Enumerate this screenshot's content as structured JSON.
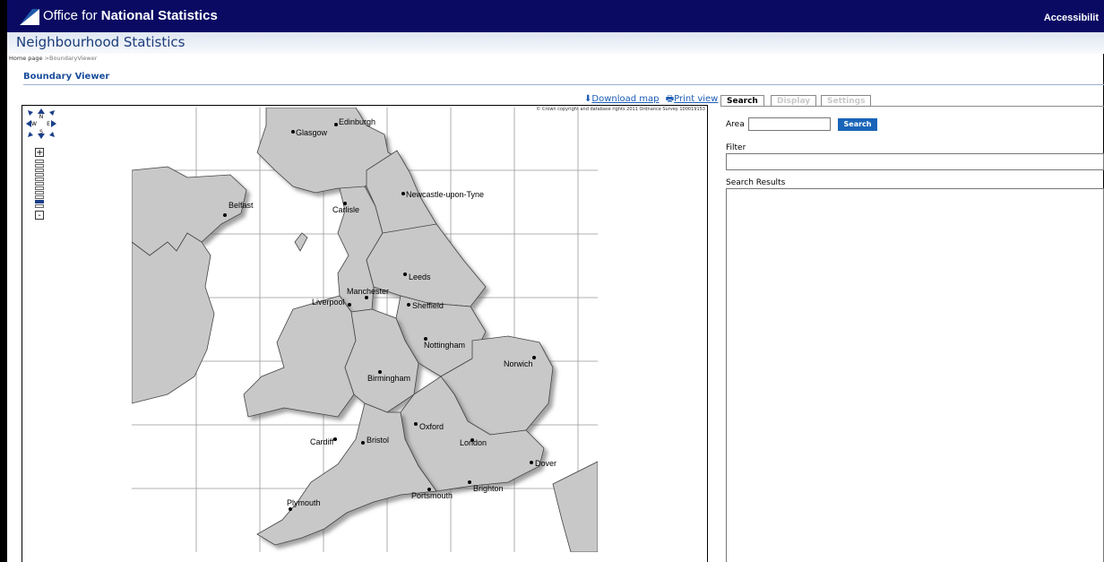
{
  "header": {
    "brand_prefix": "Office for ",
    "brand_bold": "National Statistics",
    "accessibility": "Accessibilit",
    "bar_color": "#0a0a63"
  },
  "site_title": "Neighbourhood Statistics",
  "breadcrumb": {
    "home": "Home page",
    "separator": " >",
    "current": "BoundaryViewer"
  },
  "page_title": "Boundary Viewer",
  "map_links": {
    "download": "Download map",
    "print": "Print view"
  },
  "map": {
    "copyright": "© Crown copyright and database rights 2011 Ordnance Survey 100019153",
    "compass": {
      "n": "N",
      "s": "S",
      "e": "E",
      "w": "W"
    },
    "zoom": {
      "in": "+",
      "out": "-",
      "active_level": 9,
      "levels": 11
    },
    "cities": [
      "Glasgow",
      "Edinburgh",
      "Belfast",
      "Carlisle",
      "Newcastle-upon-Tyne",
      "Leeds",
      "Manchester",
      "Liverpool",
      "Sheffield",
      "Nottingham",
      "Norwich",
      "Birmingham",
      "Oxford",
      "Cardiff",
      "Bristol",
      "London",
      "Dover",
      "Portsmouth",
      "Brighton",
      "Plymouth"
    ]
  },
  "tabs": [
    {
      "label": "Search",
      "active": true
    },
    {
      "label": "Display",
      "active": false
    },
    {
      "label": "Settings",
      "active": false
    }
  ],
  "search": {
    "area_label": "Area",
    "area_value": "",
    "button": "Search",
    "filter_label": "Filter",
    "filter_value": "",
    "results_label": "Search Results"
  }
}
